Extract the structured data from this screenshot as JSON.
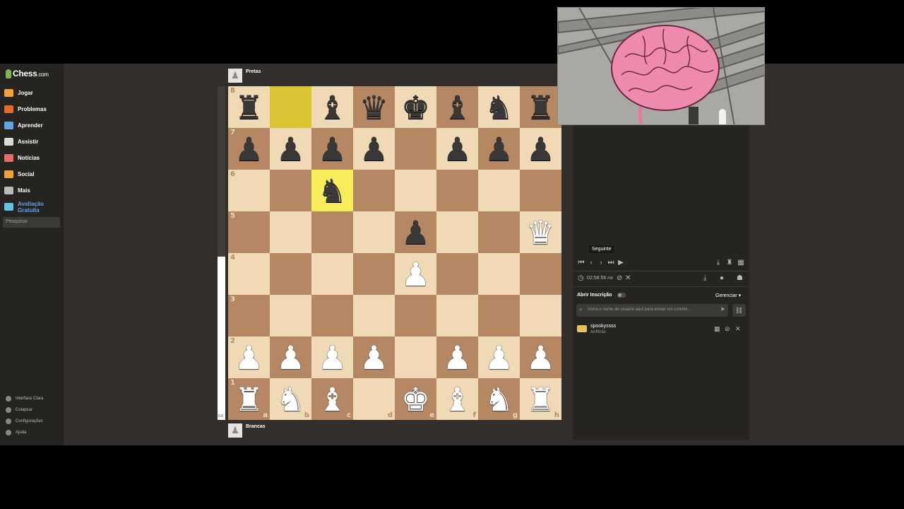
{
  "logo": {
    "text": "Chess",
    "suffix": ".com"
  },
  "nav": [
    {
      "label": "Jogar",
      "icon": "play-icon",
      "color": "#f3a13b"
    },
    {
      "label": "Problemas",
      "icon": "puzzle-icon",
      "color": "#e86a2a"
    },
    {
      "label": "Aprender",
      "icon": "learn-icon",
      "color": "#5fa3e8"
    },
    {
      "label": "Assistir",
      "icon": "binoculars-icon",
      "color": "#d9d9d9"
    },
    {
      "label": "Notícias",
      "icon": "news-icon",
      "color": "#e86a6a"
    },
    {
      "label": "Social",
      "icon": "social-icon",
      "color": "#f3a13b"
    },
    {
      "label": "Mais",
      "icon": "more-icon",
      "color": "#bab9b8"
    },
    {
      "label": "Avaliação Gratuita",
      "icon": "diamond-icon",
      "color": "#5fc3e8"
    }
  ],
  "search": {
    "placeholder": "Pesquisar"
  },
  "bottom_nav": [
    {
      "label": "Interface Clara"
    },
    {
      "label": "Colapsar"
    },
    {
      "label": "Configurações"
    },
    {
      "label": "Ajuda"
    }
  ],
  "players": {
    "top": "Pretas",
    "bottom": "Brancas"
  },
  "eval": {
    "text": "0.0",
    "white_fraction": 0.49
  },
  "board": {
    "ranks": [
      "8",
      "7",
      "6",
      "5",
      "4",
      "3",
      "2",
      "1"
    ],
    "files": [
      "a",
      "b",
      "c",
      "d",
      "e",
      "f",
      "g",
      "h"
    ],
    "rows": [
      [
        "br",
        "",
        "bb",
        "bq",
        "bk",
        "bb",
        "bn",
        "br"
      ],
      [
        "bp",
        "bp",
        "bp",
        "bp",
        "",
        "bp",
        "bp",
        "bp"
      ],
      [
        "",
        "",
        "bn",
        "",
        "",
        "",
        "",
        ""
      ],
      [
        "",
        "",
        "",
        "",
        "bp",
        "",
        "",
        "wq"
      ],
      [
        "",
        "",
        "",
        "",
        "wp",
        "",
        "",
        ""
      ],
      [
        "",
        "",
        "",
        "",
        "",
        "",
        "",
        ""
      ],
      [
        "wp",
        "wp",
        "wp",
        "wp",
        "",
        "wp",
        "wp",
        "wp"
      ],
      [
        "wr",
        "wn",
        "wb",
        "",
        "wk",
        "wb",
        "wn",
        "wr"
      ]
    ],
    "highlights": [
      "b8",
      "c6"
    ]
  },
  "controls": {
    "tooltip": "Seguinte"
  },
  "timer": {
    "text": "02:58:56",
    "suffix": "PM"
  },
  "invite": {
    "title": "Abrir Inscrição",
    "manage": "Gerenciar",
    "placeholder": "Insira o nome de usuário aqui para enviar um convite..."
  },
  "member": {
    "name": "spookyssss",
    "role": "Anfitrião"
  }
}
